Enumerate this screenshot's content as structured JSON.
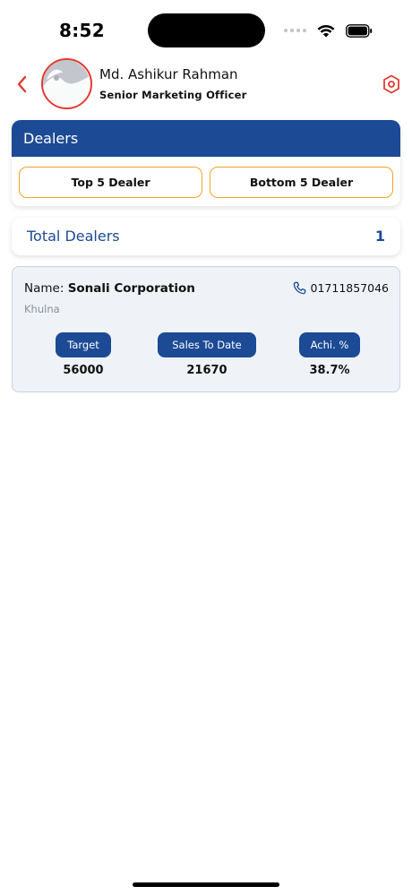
{
  "status_bar": {
    "time": "8:52"
  },
  "header": {
    "back_icon": "chevron-left-icon",
    "user_name": "Md. Ashikur Rahman",
    "user_role": "Senior Marketing Officer",
    "settings_icon": "hexagon-settings-icon"
  },
  "dealers_section": {
    "title": "Dealers",
    "filters": {
      "top_label": "Top 5 Dealer",
      "bottom_label": "Bottom 5 Dealer"
    }
  },
  "total": {
    "label": "Total Dealers",
    "count": "1"
  },
  "dealer": {
    "name_label": "Name:",
    "name": "Sonali Corporation",
    "phone": "01711857046",
    "location": "Khulna",
    "metrics": {
      "target_label": "Target",
      "target_value": "56000",
      "sales_label": "Sales To Date",
      "sales_value": "21670",
      "achi_label": "Achi. %",
      "achi_value": "38.7%"
    }
  },
  "colors": {
    "primary": "#1c4a95",
    "accent_red": "#e43a32",
    "accent_orange": "#f0a529",
    "card_bg": "#eff3f8"
  }
}
